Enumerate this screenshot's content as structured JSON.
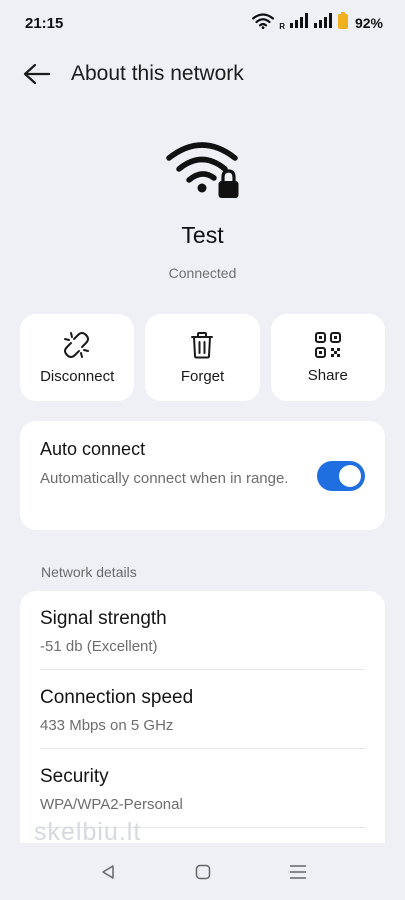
{
  "status_bar": {
    "time": "21:15",
    "roaming_indicator": "R",
    "battery_percent": "92%",
    "icons": [
      "wifi-icon",
      "signal-icon",
      "signal-icon",
      "battery-icon"
    ],
    "battery_color": "#f2b01e"
  },
  "header": {
    "title": "About this network",
    "back_icon": "arrow-left-icon"
  },
  "network": {
    "icon": "wifi-lock-icon",
    "name": "Test",
    "status": "Connected"
  },
  "actions": [
    {
      "label": "Disconnect",
      "icon": "broken-link-icon"
    },
    {
      "label": "Forget",
      "icon": "trash-icon"
    },
    {
      "label": "Share",
      "icon": "qr-code-icon"
    }
  ],
  "auto_connect": {
    "title": "Auto connect",
    "description": "Automatically connect when in range.",
    "enabled": true,
    "accent_color": "#1f6fe0"
  },
  "network_details": {
    "section_label": "Network details",
    "rows": [
      {
        "title": "Signal strength",
        "value": "-51 db (Excellent)"
      },
      {
        "title": "Connection speed",
        "value": "433 Mbps on 5 GHz"
      },
      {
        "title": "Security",
        "value": "WPA/WPA2-Personal"
      }
    ]
  },
  "watermark": "skelbiu.lt",
  "nav_bar": {
    "icons": [
      "back-triangle-icon",
      "home-square-icon",
      "recents-menu-icon"
    ]
  }
}
